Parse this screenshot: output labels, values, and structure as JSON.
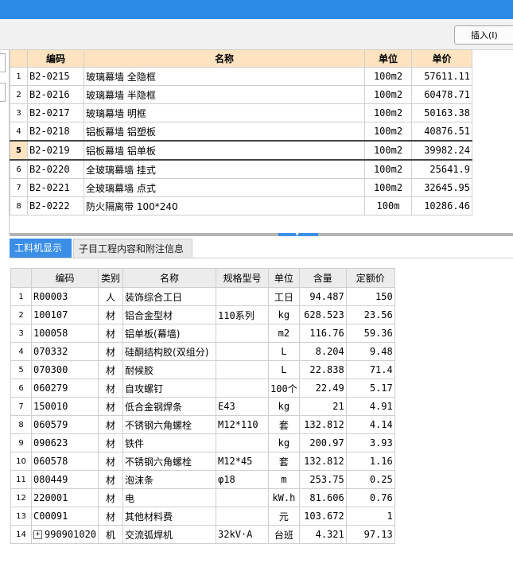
{
  "toolbar": {
    "insert_label": "插入(I)"
  },
  "upper_table": {
    "headers": {
      "code": "编码",
      "name": "名称",
      "unit": "单位",
      "price": "单价"
    },
    "rows": [
      {
        "n": "1",
        "code": "B2-0215",
        "name": "玻璃幕墙 全隐框",
        "unit": "100m2",
        "price": "57611.11"
      },
      {
        "n": "2",
        "code": "B2-0216",
        "name": "玻璃幕墙 半隐框",
        "unit": "100m2",
        "price": "60478.71"
      },
      {
        "n": "3",
        "code": "B2-0217",
        "name": "玻璃幕墙 明框",
        "unit": "100m2",
        "price": "50163.38"
      },
      {
        "n": "4",
        "code": "B2-0218",
        "name": "铝板幕墙 铝塑板",
        "unit": "100m2",
        "price": "40876.51"
      },
      {
        "n": "5",
        "code": "B2-0219",
        "name": "铝板幕墙 铝单板",
        "unit": "100m2",
        "price": "39982.24"
      },
      {
        "n": "6",
        "code": "B2-0220",
        "name": "全玻璃幕墙 挂式",
        "unit": "100m2",
        "price": "25641.9"
      },
      {
        "n": "7",
        "code": "B2-0221",
        "name": "全玻璃幕墙 点式",
        "unit": "100m2",
        "price": "32645.95"
      },
      {
        "n": "8",
        "code": "B2-0222",
        "name": "防火隔离带 100*240",
        "unit": "100m",
        "price": "10286.46"
      }
    ],
    "selected_row": 5
  },
  "tabs": {
    "labor_materials": "工料机显示",
    "subitem_info": "子目工程内容和附注信息"
  },
  "lower_table": {
    "headers": {
      "code": "编码",
      "category": "类别",
      "name": "名称",
      "spec": "规格型号",
      "unit": "单位",
      "content": "含量",
      "quota_price": "定额价"
    },
    "rows": [
      {
        "n": "1",
        "code": "R00003",
        "category": "人",
        "name": "装饰综合工日",
        "spec": "",
        "unit": "工日",
        "content": "94.487",
        "quota_price": "150"
      },
      {
        "n": "2",
        "code": "100107",
        "category": "材",
        "name": "铝合金型材",
        "spec": "110系列",
        "unit": "kg",
        "content": "628.523",
        "quota_price": "23.56"
      },
      {
        "n": "3",
        "code": "100058",
        "category": "材",
        "name": "铝单板(幕墙)",
        "spec": "",
        "unit": "m2",
        "content": "116.76",
        "quota_price": "59.36"
      },
      {
        "n": "4",
        "code": "070332",
        "category": "材",
        "name": "硅酮结构胶(双组分)",
        "spec": "",
        "unit": "L",
        "content": "8.204",
        "quota_price": "9.48"
      },
      {
        "n": "5",
        "code": "070300",
        "category": "材",
        "name": "耐候胶",
        "spec": "",
        "unit": "L",
        "content": "22.838",
        "quota_price": "71.4"
      },
      {
        "n": "6",
        "code": "060279",
        "category": "材",
        "name": "自攻螺钉",
        "spec": "",
        "unit": "100个",
        "content": "22.49",
        "quota_price": "5.17"
      },
      {
        "n": "7",
        "code": "150010",
        "category": "材",
        "name": "低合金钢焊条",
        "spec": "E43",
        "unit": "kg",
        "content": "21",
        "quota_price": "4.91"
      },
      {
        "n": "8",
        "code": "060579",
        "category": "材",
        "name": "不锈钢六角螺栓",
        "spec": "M12*110",
        "unit": "套",
        "content": "132.812",
        "quota_price": "4.14"
      },
      {
        "n": "9",
        "code": "090623",
        "category": "材",
        "name": "铁件",
        "spec": "",
        "unit": "kg",
        "content": "200.97",
        "quota_price": "3.93"
      },
      {
        "n": "10",
        "code": "060578",
        "category": "材",
        "name": "不锈钢六角螺栓",
        "spec": "M12*45",
        "unit": "套",
        "content": "132.812",
        "quota_price": "1.16"
      },
      {
        "n": "11",
        "code": "080449",
        "category": "材",
        "name": "泡沫条",
        "spec": "φ18",
        "unit": "m",
        "content": "253.75",
        "quota_price": "0.25"
      },
      {
        "n": "12",
        "code": "220001",
        "category": "材",
        "name": "电",
        "spec": "",
        "unit": "kW.h",
        "content": "81.606",
        "quota_price": "0.76"
      },
      {
        "n": "13",
        "code": "C00091",
        "category": "材",
        "name": "其他材料费",
        "spec": "",
        "unit": "元",
        "content": "103.672",
        "quota_price": "1"
      },
      {
        "n": "14",
        "code": "990901020",
        "category": "机",
        "name": "交流弧焊机",
        "spec": "32kV·A",
        "unit": "台班",
        "content": "4.321",
        "quota_price": "97.13",
        "expandable": true
      }
    ]
  },
  "colors": {
    "title_bar": "#2b8ae6",
    "header_orange": "#fde3c0",
    "tab_active": "#3a8ee6"
  }
}
